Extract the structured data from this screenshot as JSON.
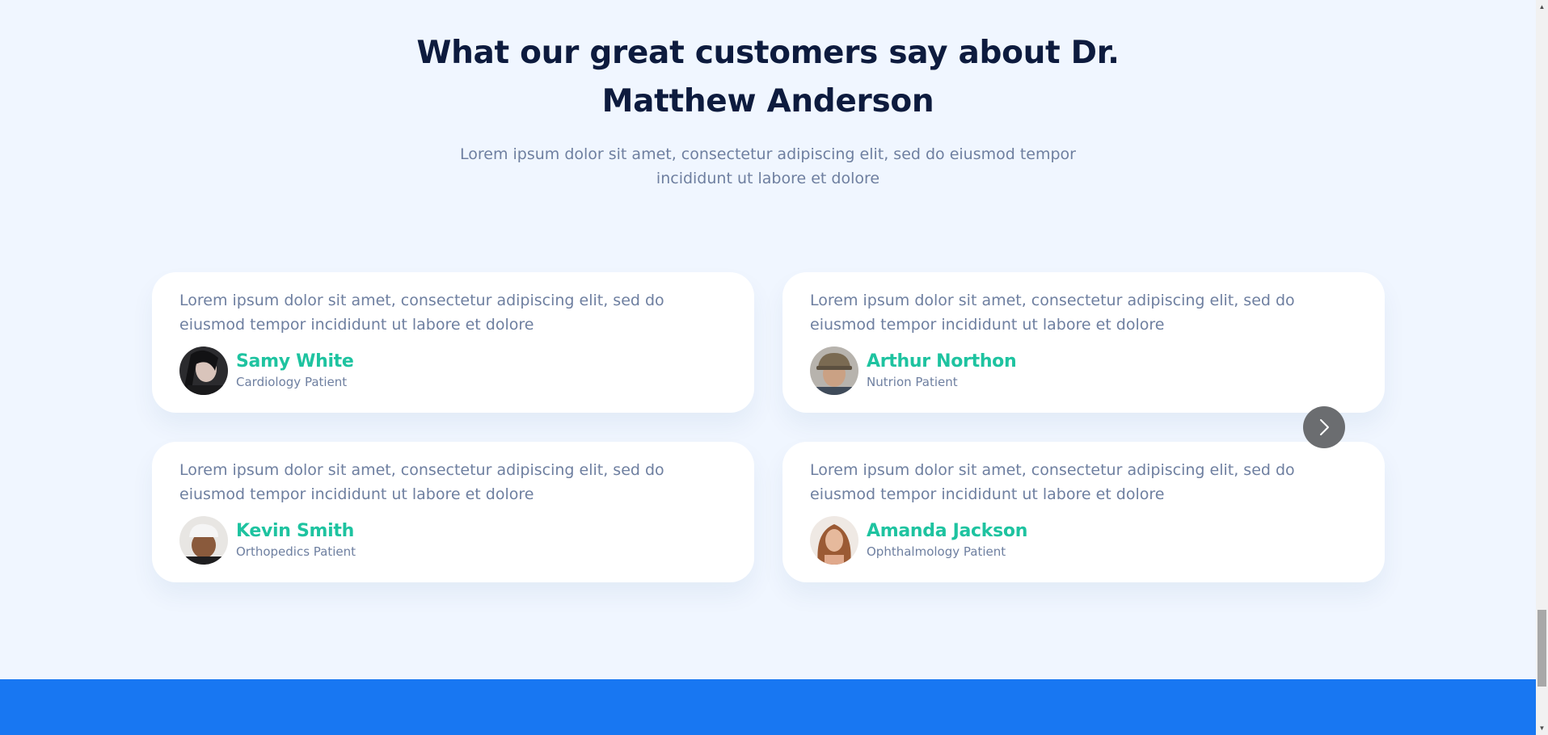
{
  "section": {
    "title": "What our great customers say about Dr. Matthew Anderson",
    "subtitle": "Lorem ipsum dolor sit amet, consectetur adipiscing elit, sed do eiusmod tempor incididunt ut labore et dolore"
  },
  "testimonials": [
    {
      "quote": "Lorem ipsum dolor sit amet, consectetur adipiscing elit, sed do eiusmod tempor incididunt ut labore et dolore",
      "name": "Samy White",
      "role": "Cardiology Patient"
    },
    {
      "quote": "Lorem ipsum dolor sit amet, consectetur adipiscing elit, sed do eiusmod tempor incididunt ut labore et dolore",
      "name": "Arthur Northon",
      "role": "Nutrion Patient"
    },
    {
      "quote": "Lorem ipsum dolor sit amet, consectetur adipiscing elit, sed do eiusmod tempor incididunt ut labore et dolore",
      "name": "Kevin Smith",
      "role": "Orthopedics Patient"
    },
    {
      "quote": "Lorem ipsum dolor sit amet, consectetur adipiscing elit, sed do eiusmod tempor incididunt ut labore et dolore",
      "name": "Amanda Jackson",
      "role": "Ophthalmology Patient"
    }
  ],
  "carousel": {
    "next_icon": "chevron-right-icon"
  },
  "scrollbar": {
    "up_icon": "triangle-up-icon",
    "down_icon": "triangle-down-icon"
  },
  "colors": {
    "background": "#f0f6ff",
    "heading": "#0d1b3e",
    "body_text": "#6e7fa0",
    "accent": "#1ec3a0",
    "footer": "#1877f2",
    "nav_button": "#6b6d70"
  }
}
